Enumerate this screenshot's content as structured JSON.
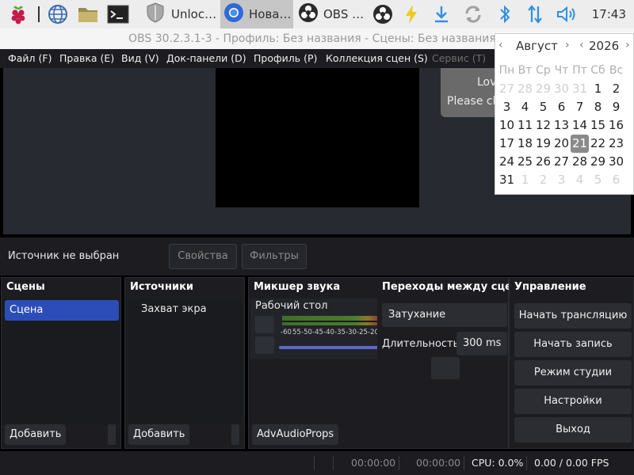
{
  "taskbar": {
    "tasks": [
      {
        "label": "Unloc…"
      },
      {
        "label": "Нова…"
      },
      {
        "label": "OBS …"
      }
    ],
    "clock": "17:43"
  },
  "window": {
    "title": "OBS 30.2.3.1-3 - Профиль: Без названия - Сцены: Без названия"
  },
  "menubar": {
    "items": [
      {
        "label": "Файл (F)"
      },
      {
        "label": "Правка (E)"
      },
      {
        "label": "Вид (V)"
      },
      {
        "label": "Док-панели (D)"
      },
      {
        "label": "Профиль (P)"
      },
      {
        "label": "Коллекция сцен (S)"
      },
      {
        "label": "Сервис (T)"
      }
    ]
  },
  "notification": {
    "line1": "Lov",
    "line2": "Please cl"
  },
  "source_bar": {
    "label": "Источник не выбран",
    "properties": "Свойства",
    "filters": "Фильтры"
  },
  "docks": {
    "scenes": {
      "title": "Сцены",
      "items": [
        "Сцена"
      ],
      "add": "Добавить"
    },
    "sources": {
      "title": "Источники",
      "items": [
        "Захват экра"
      ],
      "add": "Добавить"
    },
    "mixer": {
      "title": "Микшер звука",
      "channel": "Рабочий стол",
      "ticks": [
        "-60",
        "55",
        "-50",
        "-45",
        "-40",
        "-35",
        "-30",
        "-25",
        "-20"
      ],
      "button": "AdvAudioProps"
    },
    "transitions": {
      "title": "Переходы между сцен.",
      "selected": "Затухание",
      "duration_label": "Длительность",
      "duration_value": "300 ms"
    },
    "controls": {
      "title": "Управление",
      "buttons": [
        "Начать трансляцию",
        "Начать запись",
        "Режим студии",
        "Настройки",
        "Выход"
      ]
    }
  },
  "status": {
    "stream_time": "00:00:00",
    "record_time": "00:00:00",
    "cpu": "CPU: 0.0%",
    "fps": "0.00 / 0.00 FPS"
  },
  "calendar": {
    "month": "Август",
    "year": "2026",
    "weekdays": [
      "Пн",
      "Вт",
      "Ср",
      "Чт",
      "Пт",
      "Сб",
      "Вс"
    ],
    "weeks": [
      [
        "27",
        "28",
        "29",
        "30",
        "31",
        "1",
        "2"
      ],
      [
        "3",
        "4",
        "5",
        "6",
        "7",
        "8",
        "9"
      ],
      [
        "10",
        "11",
        "12",
        "13",
        "14",
        "15",
        "16"
      ],
      [
        "17",
        "18",
        "19",
        "20",
        "21",
        "22",
        "23"
      ],
      [
        "24",
        "25",
        "26",
        "27",
        "28",
        "29",
        "30"
      ],
      [
        "31",
        "1",
        "2",
        "3",
        "4",
        "5",
        "6"
      ]
    ],
    "today": "21"
  },
  "colors": {
    "accent": "#2c4db8",
    "panel": "#1d1d21",
    "preview_bg": "#282a31"
  }
}
